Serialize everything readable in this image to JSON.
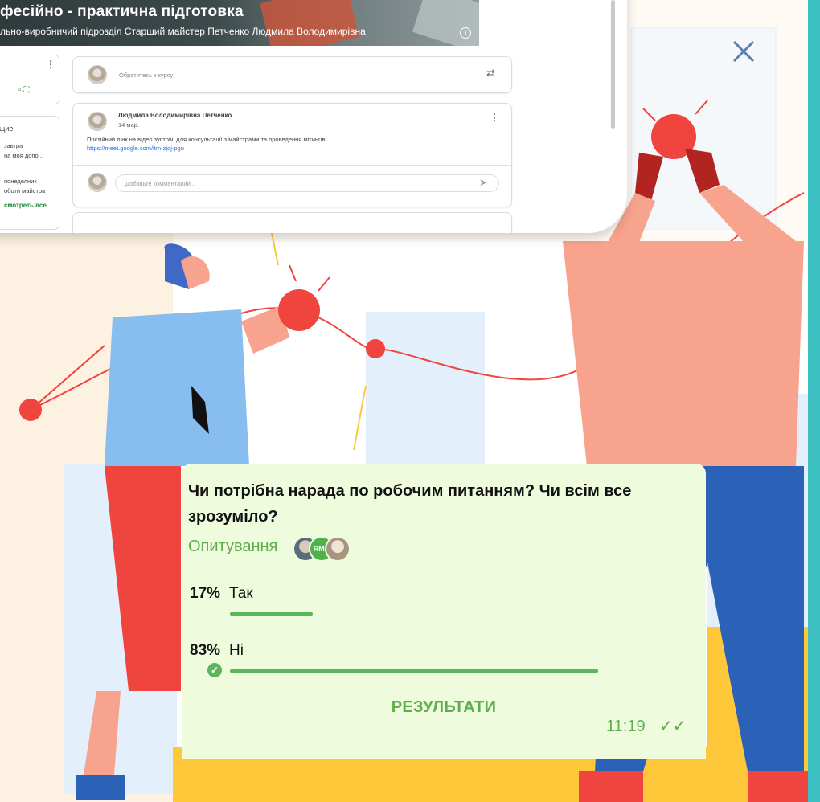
{
  "classroom": {
    "banner_title": "фесійно - практична підготовка",
    "banner_subtitle": "льно-виробничий підрозділ Старший майстер Петченко Людмила Володимирівна",
    "share_placeholder": "Обратитесь к курсу",
    "upcoming_title": "щие",
    "upcoming_lines": [
      "завтра",
      "на моя допо...",
      "понеделник",
      "оботи майстра"
    ],
    "view_all": "смотреть всё",
    "post": {
      "author": "Людмила Володимирівна Петченко",
      "date": "14 мар.",
      "text": "Постійний лінк на відео зустрічі для консультації з майстрами та проведення мітингів.",
      "link": "https://meet.google.com/itm-zjqj-pgu",
      "comment_placeholder": "Добавьте комментарий..."
    }
  },
  "poll": {
    "question": "Чи потрібна нарада по робочим питанням? Чи всім все зрозуміло?",
    "type_label": "Опитування",
    "voter_initials": "ЯМА",
    "options": [
      {
        "percent": "17%",
        "label": "Так",
        "fraction": 0.17
      },
      {
        "percent": "83%",
        "label": "Ні",
        "fraction": 0.83,
        "selected": true
      }
    ],
    "results_button": "РЕЗУЛЬТАТИ",
    "time": "11:19",
    "read_marks": "✓✓"
  },
  "colors": {
    "accent_green": "#5cb55a",
    "poll_bg": "#eefbdd",
    "teal_border": "#3cbfc0",
    "figure_red": "#f0453f",
    "figure_blue": "#2b62b7"
  },
  "icons": [
    "info-icon",
    "repost-icon",
    "more-vert-icon",
    "send-icon",
    "close-icon",
    "check-icon",
    "double-check-icon"
  ]
}
